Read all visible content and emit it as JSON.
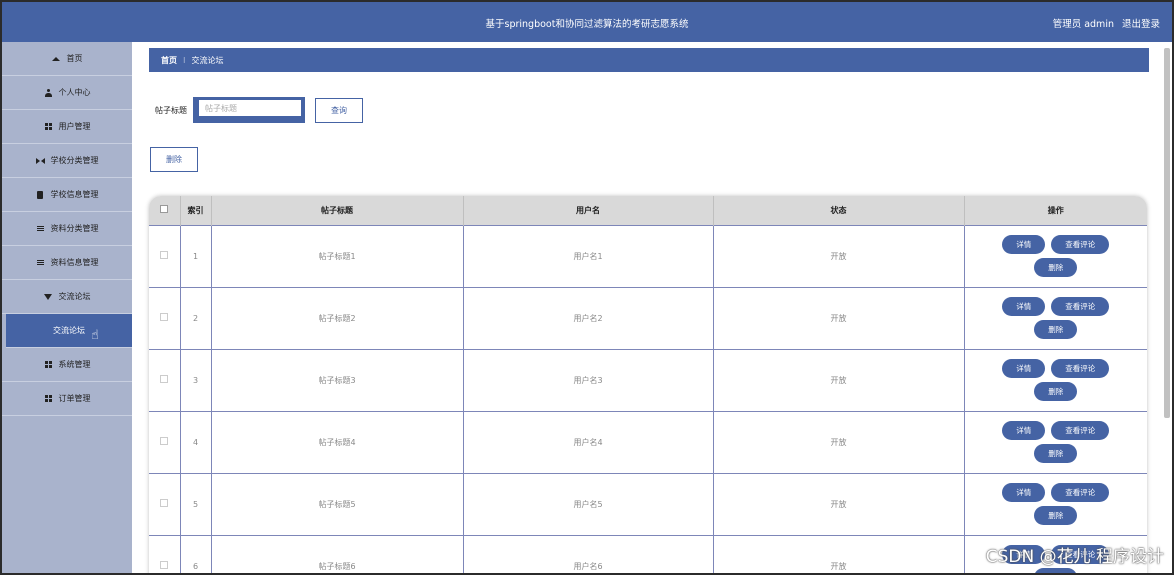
{
  "header": {
    "title": "基于springboot和协同过滤算法的考研志愿系统",
    "user": "管理员 admin",
    "logout": "退出登录"
  },
  "sidebar": {
    "items": [
      {
        "label": "首页",
        "icon": "home-icon"
      },
      {
        "label": "个人中心",
        "icon": "person-icon"
      },
      {
        "label": "用户管理",
        "icon": "grid-icon"
      },
      {
        "label": "学校分类管理",
        "icon": "bowtie-icon"
      },
      {
        "label": "学校信息管理",
        "icon": "document-icon"
      },
      {
        "label": "资料分类管理",
        "icon": "list-icon"
      },
      {
        "label": "资料信息管理",
        "icon": "list-icon"
      },
      {
        "label": "交流论坛",
        "icon": "funnel-icon"
      },
      {
        "label": "交流论坛",
        "icon": "",
        "active": true
      },
      {
        "label": "系统管理",
        "icon": "grid-icon"
      },
      {
        "label": "订单管理",
        "icon": "grid-icon"
      }
    ]
  },
  "breadcrumb": {
    "home": "首页",
    "separator": "⁝",
    "current": "交流论坛"
  },
  "search": {
    "label": "帖子标题",
    "placeholder": "帖子标题",
    "query_button": "查询"
  },
  "delete_button": "删除",
  "table": {
    "headers": [
      "索引",
      "帖子标题",
      "用户名",
      "状态",
      "操作"
    ],
    "rows": [
      {
        "index": "1",
        "title": "帖子标题1",
        "user": "用户名1",
        "status": "开放"
      },
      {
        "index": "2",
        "title": "帖子标题2",
        "user": "用户名2",
        "status": "开放"
      },
      {
        "index": "3",
        "title": "帖子标题3",
        "user": "用户名3",
        "status": "开放"
      },
      {
        "index": "4",
        "title": "帖子标题4",
        "user": "用户名4",
        "status": "开放"
      },
      {
        "index": "5",
        "title": "帖子标题5",
        "user": "用户名5",
        "status": "开放"
      },
      {
        "index": "6",
        "title": "帖子标题6",
        "user": "用户名6",
        "status": "开放"
      }
    ],
    "ops": {
      "detail": "详情",
      "comments": "查看评论",
      "delete": "删除"
    }
  },
  "watermark": "CSDN @花儿 程序设计",
  "colors": {
    "primary": "#4563a4",
    "sidebar": "#a9b3cc",
    "header_row": "#d9d9d9"
  }
}
